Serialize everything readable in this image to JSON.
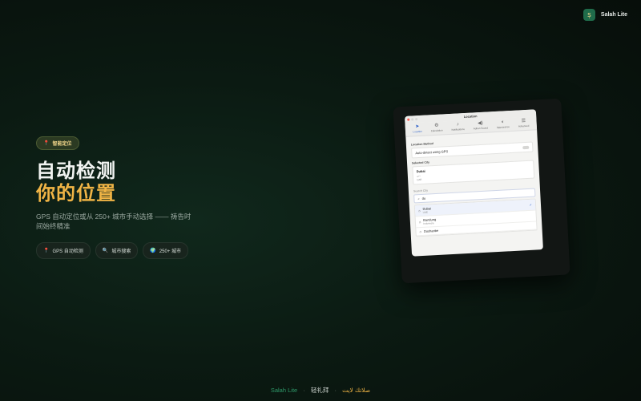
{
  "brand": {
    "logo_glyph": "ṣ",
    "name": "Salah Lite",
    "accent": "#1f6b4a"
  },
  "hero": {
    "tag": "智能定位",
    "headline_line1": "自动检测",
    "headline_line2": "你的位置",
    "subtitle": "GPS 自动定位或从 250+ 城市手动选择 —— 祷告时间始终精准",
    "chips": [
      {
        "icon": "pin-icon",
        "label": "GPS 自动检测"
      },
      {
        "icon": "magnifier-icon",
        "label": "城市搜索"
      },
      {
        "icon": "globe-icon",
        "label": "250+ 城市"
      }
    ],
    "colors": {
      "gold": "#f0b445",
      "tag_text": "#f0d58a"
    }
  },
  "window": {
    "title": "Location",
    "tabs": [
      "Location",
      "Calculation",
      "Notifications",
      "Adhan Sound",
      "Appearance",
      "Advanced"
    ],
    "location_method_label": "Location Method",
    "auto_detect_label": "Auto-detect using GPS",
    "selected_city_label": "Selected City",
    "selected_city": {
      "name": "Dubai",
      "arabic": "دبي",
      "country": "UAE"
    },
    "search_label": "Search City",
    "search_value": "du",
    "results": [
      {
        "name": "Dubai",
        "country": "UAE",
        "selected": true
      },
      {
        "name": "Bandung",
        "country": "Indonesia",
        "selected": false
      },
      {
        "name": "Dushanbe",
        "country": "",
        "selected": false
      }
    ]
  },
  "footer": {
    "app": "Salah Lite",
    "sep": "·",
    "zh": "轻礼拜",
    "ar": "صلاتك لايت"
  }
}
